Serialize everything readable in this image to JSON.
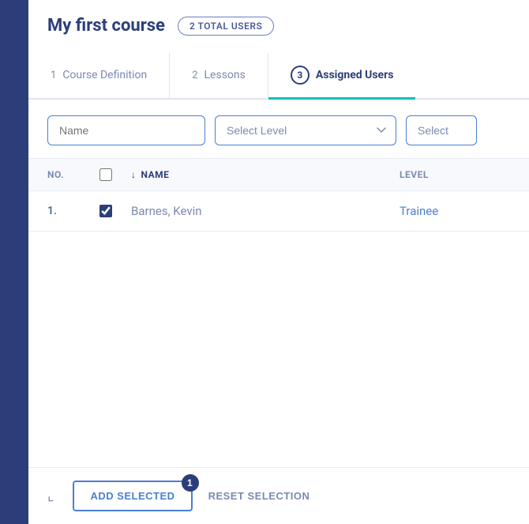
{
  "header": {
    "course_title": "My first course",
    "total_users_badge": "2 TOTAL USERS"
  },
  "tabs": [
    {
      "number": "1",
      "label": "Course Definition",
      "active": false
    },
    {
      "number": "2",
      "label": "Lessons",
      "active": false
    },
    {
      "number": "3",
      "label": "Assigned Users",
      "active": true
    }
  ],
  "filters": {
    "name_placeholder": "Name",
    "level_placeholder": "Select Level",
    "select_placeholder": "Select"
  },
  "table": {
    "headers": {
      "no": "NO.",
      "name": "NAME",
      "level": "LEVEL"
    },
    "rows": [
      {
        "no": "1.",
        "name": "Barnes, Kevin",
        "level": "Trainee",
        "checked": true
      }
    ]
  },
  "actions": {
    "add_selected_label": "ADD SELECTED",
    "reset_selection_label": "RESET SELECTION",
    "selected_count": "1"
  }
}
